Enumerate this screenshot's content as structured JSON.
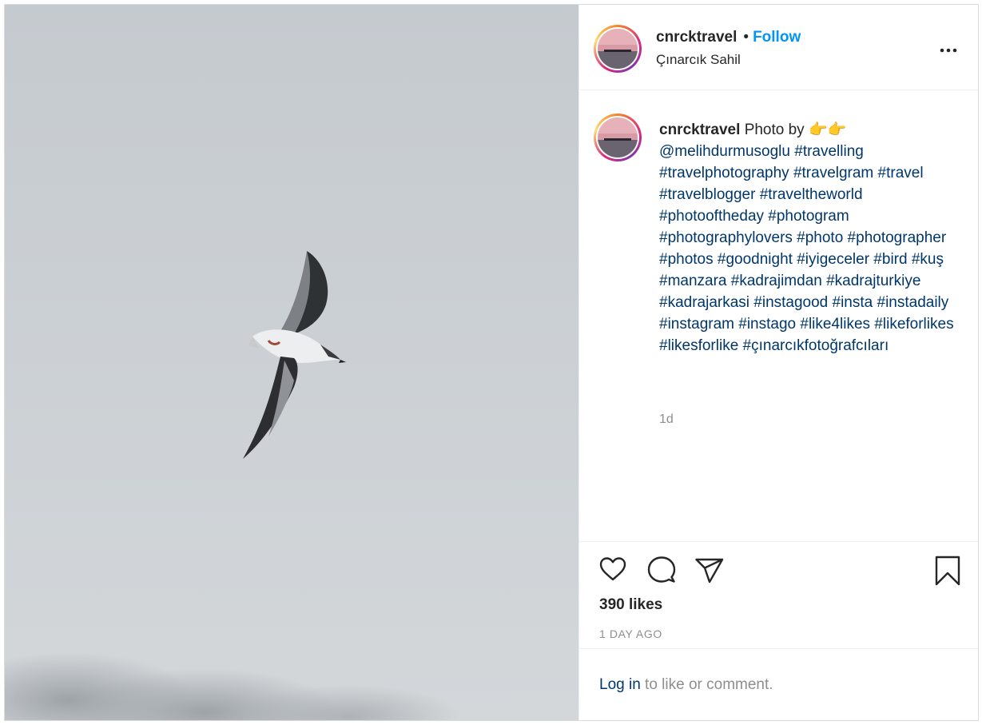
{
  "post": {
    "username": "cnrcktravel",
    "follow_label": "Follow",
    "separator": "•",
    "location": "Çınarcık Sahil",
    "more_label": "•••",
    "caption_lead": "Photo by 👉👉",
    "caption_tags": "@melihdurmusoglu #travelling #travelphotography #travelgram #travel #travelblogger #traveltheworld #photooftheday #photogram #photographylovers #photo #photographer #photos #goodnight #iyigeceler #bird #kuş #manzara #kadrajimdan #kadrajturkiye #kadrajarkasi #instagood #insta #instadaily #instagram #instago #like4likes #likeforlikes #likesforlike #çınarcıkfotoğrafcıları",
    "caption_age": "1d",
    "likes": "390 likes",
    "posted_ago": "1 DAY AGO",
    "login_link": "Log in",
    "login_rest": " to like or comment."
  },
  "icons": [
    "heart-icon",
    "comment-icon",
    "share-icon",
    "bookmark-icon",
    "more-icon"
  ],
  "colors": {
    "follow": "#0095f6",
    "hashtag": "#00376b",
    "muted": "#8e8e8e",
    "sky": "#c9ced3"
  }
}
